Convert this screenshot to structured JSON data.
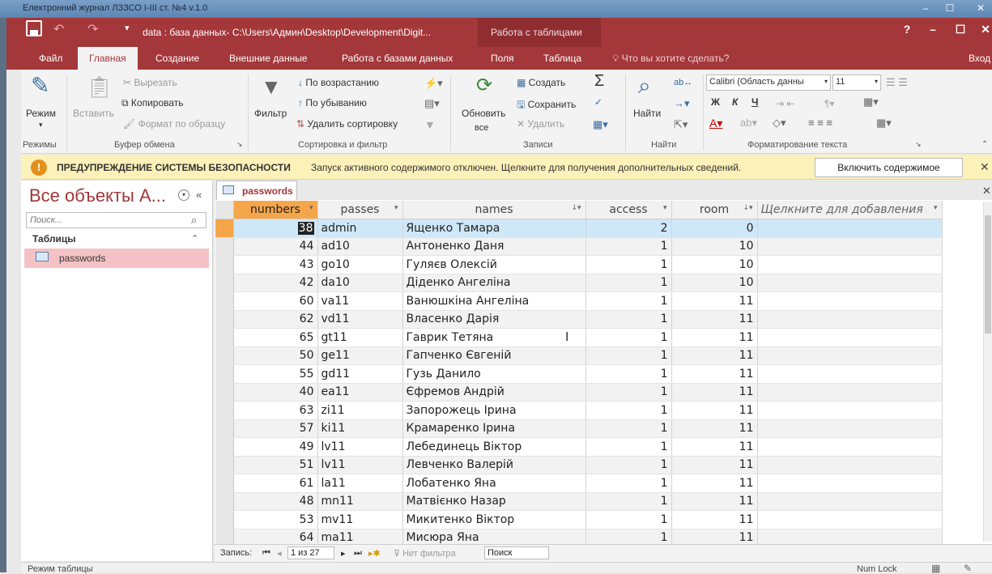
{
  "outer_window": {
    "title": "Електронний журнал ЛЗЗСО І-ІІІ ст. №4 v.1.0"
  },
  "titlebar": {
    "doc_title": "data : база данных- C:\\Users\\Админ\\Desktop\\Development\\Digit...",
    "context_title": "Работа с таблицами",
    "help": "?",
    "minimize": "–",
    "restore": "☐",
    "close": "✕"
  },
  "tabs": [
    {
      "label": "Файл"
    },
    {
      "label": "Главная"
    },
    {
      "label": "Создание"
    },
    {
      "label": "Внешние данные"
    },
    {
      "label": "Работа с базами данных"
    },
    {
      "label": "Поля"
    },
    {
      "label": "Таблица"
    },
    {
      "label": "Что вы хотите сделать?"
    },
    {
      "label": "Вход"
    }
  ],
  "ribbon": {
    "modes": {
      "view_label": "Режим",
      "group": "Режимы"
    },
    "clipboard": {
      "paste": "Вставить",
      "cut": "Вырезать",
      "copy": "Копировать",
      "format_painter": "Формат по образцу",
      "group": "Буфер обмена"
    },
    "sort_filter": {
      "filter": "Фильтр",
      "ascending": "По возрастанию",
      "descending": "По убыванию",
      "remove_sort": "Удалить сортировку",
      "group": "Сортировка и фильтр"
    },
    "records": {
      "refresh": "Обновить",
      "refresh_sub": "все",
      "new": "Создать",
      "save": "Сохранить",
      "delete": "Удалить",
      "group": "Записи"
    },
    "find": {
      "find": "Найти",
      "group": "Найти"
    },
    "text_format": {
      "font": "Calibri (Область данны",
      "size": "11",
      "bold": "Ж",
      "italic": "К",
      "underline": "Ч",
      "group": "Форматирование текста"
    }
  },
  "security": {
    "icon": "!",
    "title": "ПРЕДУПРЕЖДЕНИЕ СИСТЕМЫ БЕЗОПАСНОСТИ",
    "text": "Запуск активного содержимого отключен. Щелкните для получения дополнительных сведений.",
    "button": "Включить содержимое",
    "close": "✕"
  },
  "nav": {
    "title": "Все объекты A...",
    "search_placeholder": "Поиск...",
    "group": "Таблицы",
    "items": [
      {
        "label": "passwords"
      }
    ]
  },
  "doc_tab": {
    "label": "passwords",
    "close": "✕"
  },
  "table": {
    "columns": [
      "numbers",
      "passes",
      "names",
      "access",
      "room",
      "Щелкните для добавления"
    ],
    "rows": [
      [
        "38",
        "admin",
        "Ященко Тамара",
        "2",
        "0"
      ],
      [
        "44",
        "ad10",
        "Антоненко Даня",
        "1",
        "10"
      ],
      [
        "43",
        "go10",
        "Гуляєв Олексій",
        "1",
        "10"
      ],
      [
        "42",
        "da10",
        "Діденко Ангеліна",
        "1",
        "10"
      ],
      [
        "60",
        "va11",
        "Ванюшкіна Ангеліна",
        "1",
        "11"
      ],
      [
        "62",
        "vd11",
        "Власенко Дарія",
        "1",
        "11"
      ],
      [
        "65",
        "gt11",
        "Гаврик Тетяна",
        "1",
        "11"
      ],
      [
        "50",
        "ge11",
        "Гапченко Євгеній",
        "1",
        "11"
      ],
      [
        "55",
        "gd11",
        "Гузь Данило",
        "1",
        "11"
      ],
      [
        "40",
        "ea11",
        "Єфремов Андрій",
        "1",
        "11"
      ],
      [
        "63",
        "zi11",
        "Запорожець Ірина",
        "1",
        "11"
      ],
      [
        "57",
        "ki11",
        "Крамаренко Ірина",
        "1",
        "11"
      ],
      [
        "49",
        "lv11",
        "Лебединець Віктор",
        "1",
        "11"
      ],
      [
        "51",
        "lv11",
        "Левченко Валерій",
        "1",
        "11"
      ],
      [
        "61",
        "la11",
        "Лобатенко Яна",
        "1",
        "11"
      ],
      [
        "48",
        "mn11",
        "Матвієнко Назар",
        "1",
        "11"
      ],
      [
        "53",
        "mv11",
        "Микитенко Віктор",
        "1",
        "11"
      ],
      [
        "64",
        "ma11",
        "Мисюра Яна",
        "1",
        "11"
      ]
    ]
  },
  "record_nav": {
    "label": "Запись:",
    "position": "1 из 27",
    "filter": "Нет фильтра",
    "search": "Поиск"
  },
  "status": {
    "mode": "Режим таблицы",
    "numlock": "Num Lock"
  },
  "colors": {
    "accent": "#a4373a",
    "selected_header": "#f5a64a",
    "selected_row": "#cfe8f8",
    "nav_selected": "#f4c2c4",
    "warning_bar": "#fdf1ba"
  }
}
